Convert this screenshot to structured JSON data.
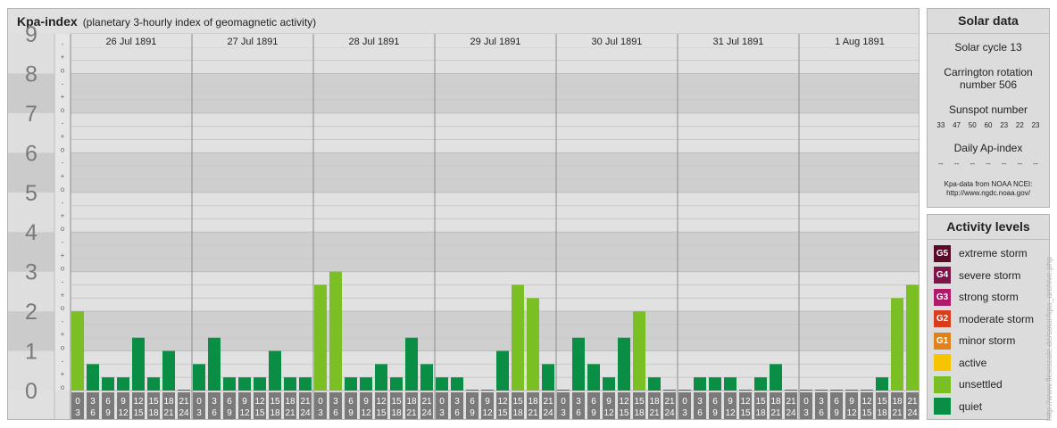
{
  "title": {
    "main": "Kpa-index",
    "subtitle": "(planetary 3-hourly index of geomagnetic activity)"
  },
  "chart_data": {
    "type": "bar",
    "ylim": [
      0,
      9
    ],
    "y_major_ticks": [
      "0",
      "1",
      "2",
      "3",
      "4",
      "5",
      "6",
      "7",
      "8",
      "9"
    ],
    "y_minor_ticks": [
      "o",
      "+",
      "-"
    ],
    "days": [
      "26 Jul 1891",
      "27 Jul 1891",
      "28 Jul 1891",
      "29 Jul 1891",
      "30 Jul 1891",
      "31 Jul 1891",
      "1 Aug 1891"
    ],
    "interval_labels": [
      [
        "0",
        "3"
      ],
      [
        "3",
        "6"
      ],
      [
        "6",
        "9"
      ],
      [
        "9",
        "12"
      ],
      [
        "12",
        "15"
      ],
      [
        "15",
        "18"
      ],
      [
        "18",
        "21"
      ],
      [
        "21",
        "24"
      ]
    ],
    "values": [
      [
        2.0,
        0.667,
        0.333,
        0.333,
        1.333,
        0.333,
        1.0,
        0.0
      ],
      [
        0.667,
        1.333,
        0.333,
        0.333,
        0.333,
        1.0,
        0.333,
        0.333
      ],
      [
        2.667,
        3.0,
        0.333,
        0.333,
        0.667,
        0.333,
        1.333,
        0.667
      ],
      [
        0.333,
        0.333,
        0.0,
        0.0,
        1.0,
        2.667,
        2.333,
        0.667
      ],
      [
        0.0,
        1.333,
        0.667,
        0.333,
        1.333,
        2.0,
        0.333,
        0.0
      ],
      [
        0.0,
        0.333,
        0.333,
        0.333,
        0.0,
        0.333,
        0.667,
        0.0
      ],
      [
        0.0,
        0.0,
        0.0,
        0.0,
        0.0,
        0.333,
        2.333,
        2.667
      ]
    ],
    "level_colors": {
      "quiet": "#0a8e45",
      "unsettled": "#7abf24"
    }
  },
  "solar": {
    "title": "Solar data",
    "cycle": "Solar cycle 13",
    "carrington": [
      "Carrington rotation",
      "number 506"
    ],
    "sunspot_label": "Sunspot number",
    "sunspots": [
      "33",
      "47",
      "50",
      "60",
      "23",
      "22",
      "23"
    ],
    "ap_label": "Daily Ap-index",
    "ap_values": [
      "--",
      "--",
      "--",
      "--",
      "--",
      "--",
      "--"
    ],
    "source_line1": "Kpa-data from NOAA NCEI:",
    "source_line2": "http://www.ngdc.noaa.gov/"
  },
  "levels": {
    "title": "Activity levels",
    "items": [
      {
        "code": "G5",
        "label": "extreme storm",
        "color": "#5a0a28"
      },
      {
        "code": "G4",
        "label": "severe storm",
        "color": "#7e1448"
      },
      {
        "code": "G3",
        "label": "strong storm",
        "color": "#b0186a"
      },
      {
        "code": "G2",
        "label": "moderate storm",
        "color": "#d83d1e"
      },
      {
        "code": "G1",
        "label": "minor storm",
        "color": "#e0821a"
      },
      {
        "code": "",
        "label": "active",
        "color": "#f6c400"
      },
      {
        "code": "",
        "label": "unsettled",
        "color": "#7abf24"
      },
      {
        "code": "",
        "label": "quiet",
        "color": "#0a8e45"
      }
    ]
  },
  "credit": "http://www.flexiscale.de/solar/kpa_archive.php"
}
